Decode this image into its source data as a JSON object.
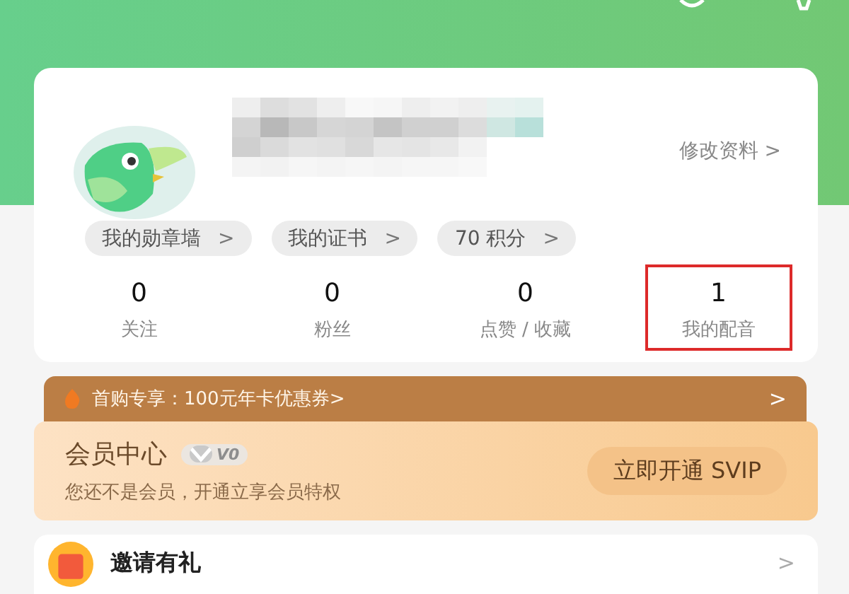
{
  "profile": {
    "edit_link": "修改资料 >"
  },
  "chips": [
    {
      "label": "我的勋章墙",
      "arrow": ">"
    },
    {
      "label": "我的证书",
      "arrow": ">"
    },
    {
      "label": "70 积分",
      "arrow": ">"
    }
  ],
  "stats": [
    {
      "value": "0",
      "label": "关注",
      "highlighted": false
    },
    {
      "value": "0",
      "label": "粉丝",
      "highlighted": false
    },
    {
      "value": "0",
      "label": "点赞 / 收藏",
      "highlighted": false
    },
    {
      "value": "1",
      "label": "我的配音",
      "highlighted": true
    }
  ],
  "promo": {
    "text": "首购专享：100元年卡优惠券>",
    "arrow": ">"
  },
  "member": {
    "title": "会员中心",
    "level": "V0",
    "subtitle": "您还不是会员，开通立享会员特权",
    "button": "立即开通 SVIP"
  },
  "menu": [
    {
      "label": "邀请有礼",
      "arrow": ">"
    }
  ]
}
